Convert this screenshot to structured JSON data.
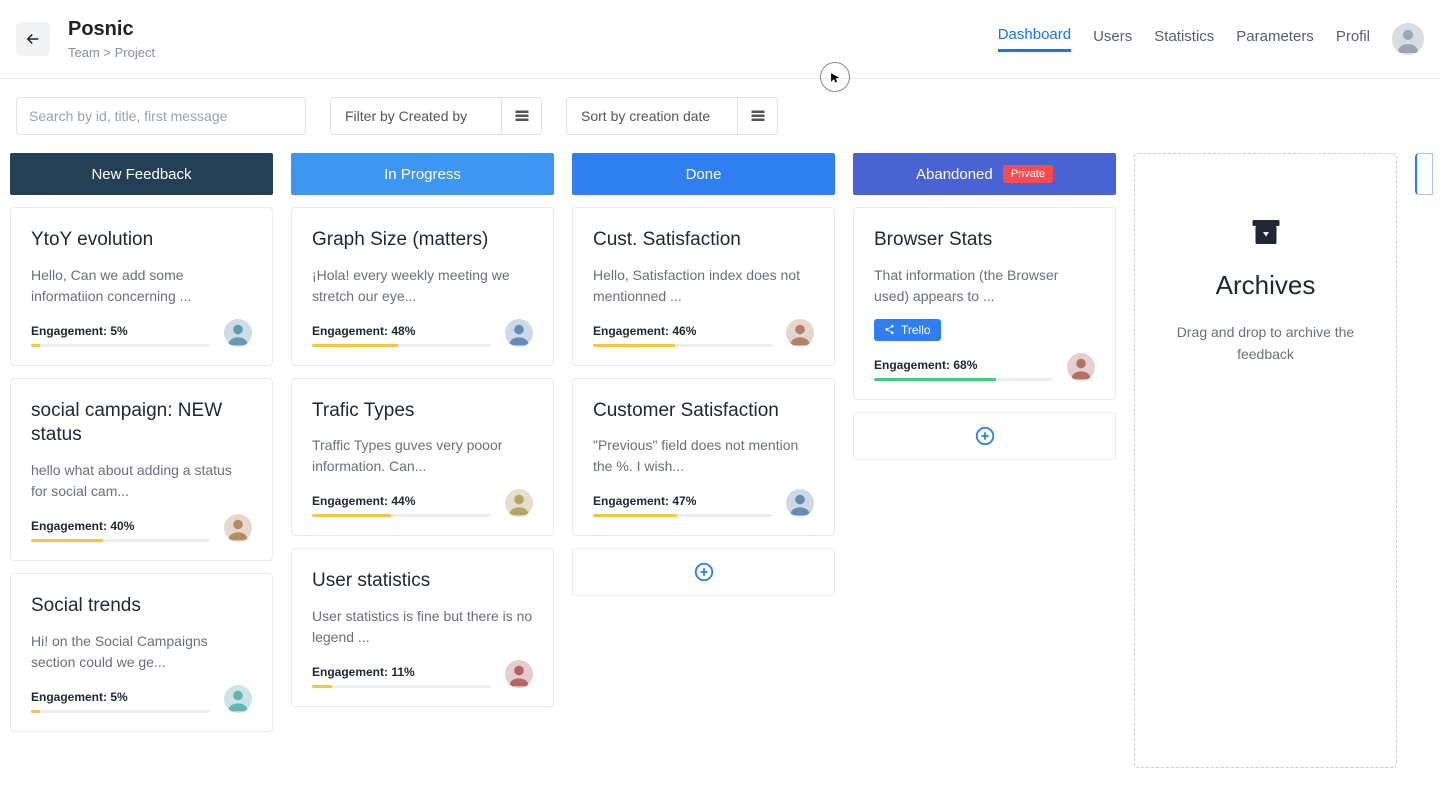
{
  "header": {
    "title": "Posnic",
    "breadcrumb": "Team > Project",
    "nav": [
      "Dashboard",
      "Users",
      "Statistics",
      "Parameters",
      "Profil"
    ],
    "active_nav": "Dashboard"
  },
  "filters": {
    "search_placeholder": "Search by id, title, first message",
    "filter_label": "Filter by Created by",
    "sort_label": "Sort by creation date"
  },
  "columns": [
    {
      "id": "new_feedback",
      "title": "New Feedback",
      "header_class": "hdr-newfeedback",
      "striped": false,
      "cards": [
        {
          "title": "YtoY evolution",
          "message": "Hello, Can we add some informatiion concerning ...",
          "engagement": 5,
          "engagement_label": "Engagement: 5%",
          "avatar": "a1"
        },
        {
          "title": "social campaign: NEW status",
          "message": "hello what about adding a status for social cam...",
          "engagement": 40,
          "engagement_label": "Engagement: 40%",
          "avatar": "a2"
        },
        {
          "title": "Social trends",
          "message": "Hi! on the Social Campaigns section could we ge...",
          "engagement": 5,
          "engagement_label": "Engagement: 5%",
          "avatar": "a3"
        }
      ],
      "show_add": false
    },
    {
      "id": "in_progress",
      "title": "In Progress",
      "header_class": "hdr-inprogress",
      "striped": false,
      "cards": [
        {
          "title": "Graph Size (matters)",
          "message": "¡Hola! every weekly meeting we stretch our eye...",
          "engagement": 48,
          "engagement_label": "Engagement: 48%",
          "avatar": "a4"
        },
        {
          "title": "Trafic Types",
          "message": "Traffic Types guves very pooor information. Can...",
          "engagement": 44,
          "engagement_label": "Engagement: 44%",
          "avatar": "a5"
        },
        {
          "title": "User statistics",
          "message": "User statistics is fine but there is no legend ...",
          "engagement": 11,
          "engagement_label": "Engagement: 11%",
          "avatar": "a6"
        }
      ],
      "show_add": false
    },
    {
      "id": "done",
      "title": "Done",
      "header_class": "hdr-done",
      "striped": false,
      "cards": [
        {
          "title": "Cust. Satisfaction",
          "message": "Hello, Satisfaction index does not mentionned ...",
          "engagement": 46,
          "engagement_label": "Engagement: 46%",
          "avatar": "a7"
        },
        {
          "title": "Customer Satisfaction",
          "message": "\"Previous\" field does not mention the %. I wish...",
          "engagement": 47,
          "engagement_label": "Engagement: 47%",
          "avatar": "a8"
        }
      ],
      "show_add": true
    },
    {
      "id": "abandoned",
      "title": "Abandoned",
      "header_class": "hdr-abandoned",
      "striped": true,
      "private": true,
      "private_label": "Private",
      "cards": [
        {
          "title": "Browser Stats",
          "message": "That information (the Browser used) appears to ...",
          "engagement": 68,
          "engagement_label": "Engagement: 68%",
          "engagement_color": "green",
          "trello": true,
          "trello_label": "Trello",
          "avatar": "a9"
        }
      ],
      "show_add": true
    }
  ],
  "archives": {
    "title": "Archives",
    "hint": "Drag and drop to archive the feedback"
  }
}
